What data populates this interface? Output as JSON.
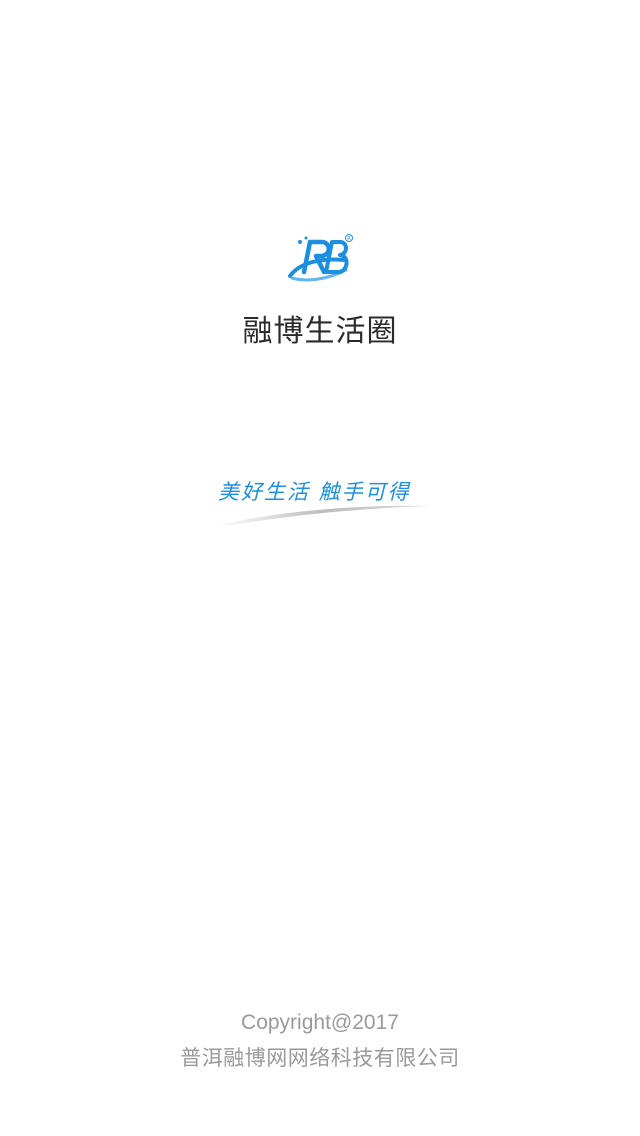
{
  "splash": {
    "logo_text": "RB",
    "app_name": "融博生活圈",
    "slogan": "美好生活 触手可得"
  },
  "footer": {
    "copyright": "Copyright@2017",
    "company": "普洱融博网网络科技有限公司"
  },
  "colors": {
    "brand_blue": "#1c8fe0",
    "title_text": "#2b2b2b",
    "footer_text": "#9a9a9a",
    "background": "#ffffff"
  }
}
